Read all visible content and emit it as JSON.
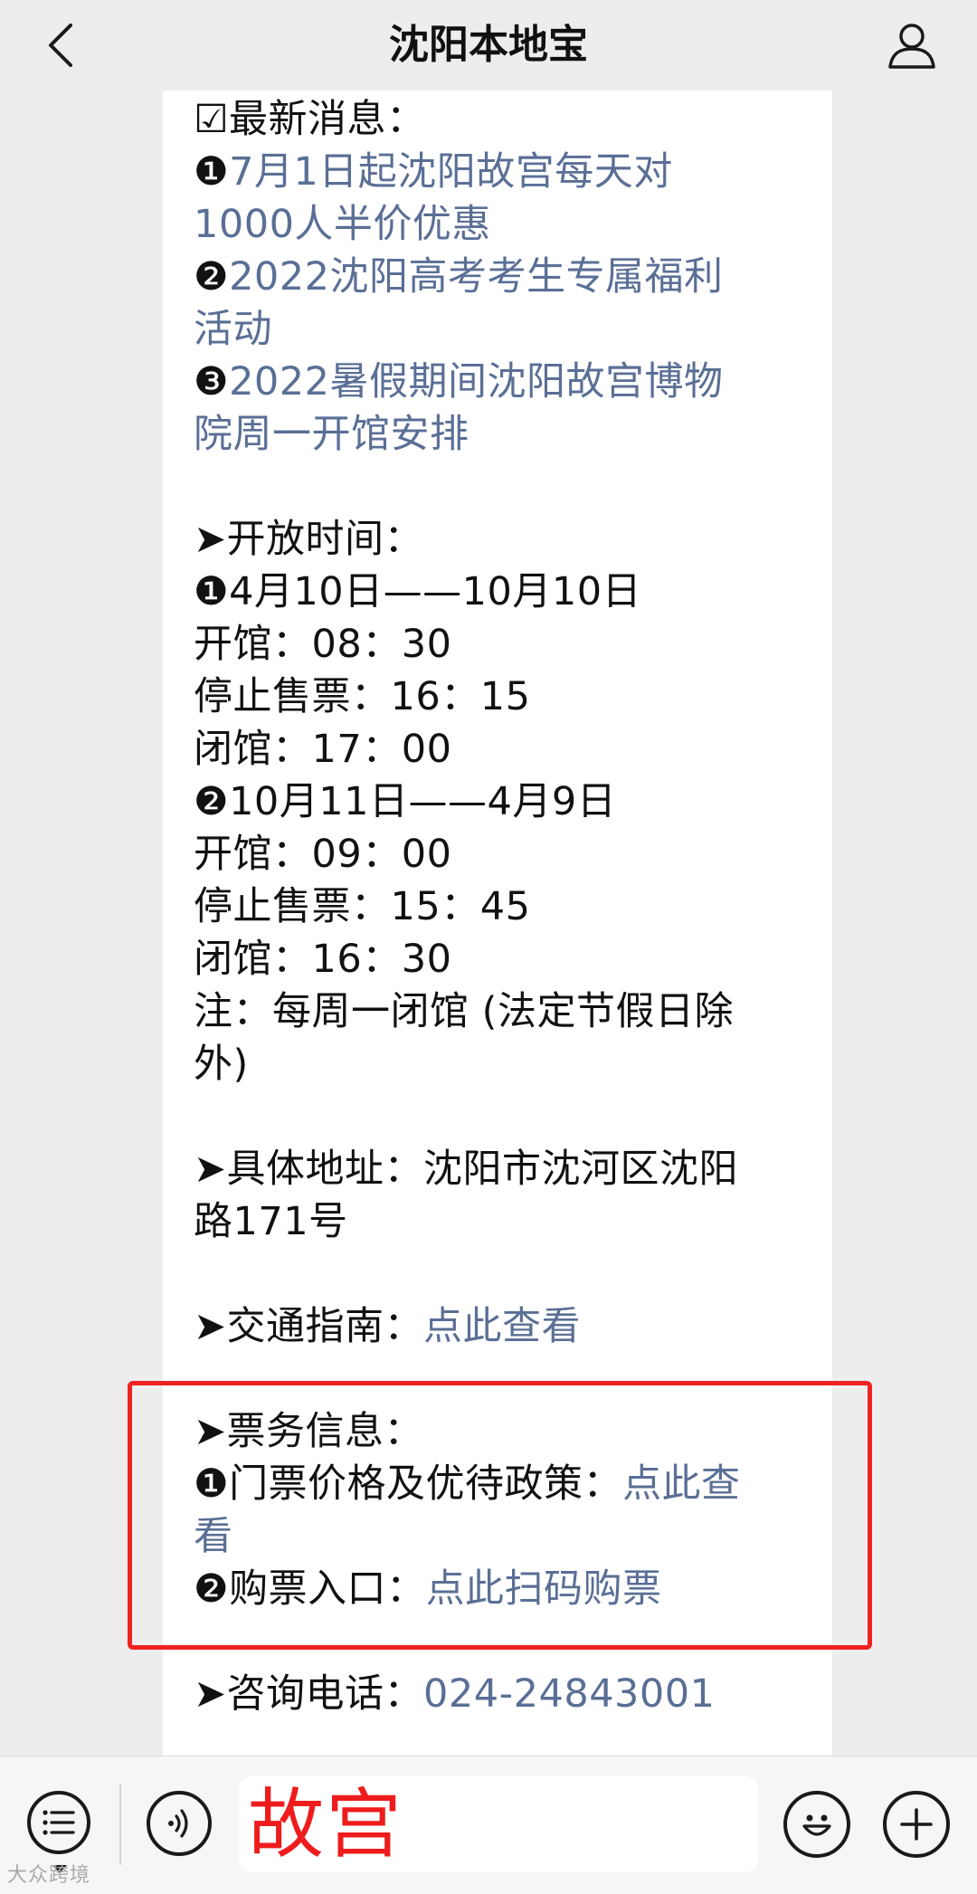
{
  "nav": {
    "title": "沈阳本地宝",
    "back_icon": "chevron-left-icon",
    "profile_icon": "person-icon"
  },
  "message": {
    "news": {
      "heading": "☑最新消息：",
      "items": [
        {
          "marker": "❶",
          "text_line1": "7月1日起沈阳故宫每天对",
          "text_line2": "1000人半价优惠"
        },
        {
          "marker": "❷",
          "text_line1": "2022沈阳高考考生专属福利",
          "text_line2": "活动"
        },
        {
          "marker": "❸",
          "text_line1": "2022暑假期间沈阳故宫博物",
          "text_line2": "院周一开馆安排"
        }
      ]
    },
    "hours": {
      "heading": "➤开放时间：",
      "season1": {
        "marker": "❶",
        "range": "4月10日——10月10日",
        "open": "开馆：08：30",
        "stop_sale": "停止售票：16：15",
        "close": "闭馆：17：00"
      },
      "season2": {
        "marker": "❷",
        "range": "10月11日——4月9日",
        "open": "开馆：09：00",
        "stop_sale": "停止售票：15：45",
        "close": "闭馆：16：30"
      },
      "note_line1": "注：每周一闭馆 (法定节假日除",
      "note_line2": "外)"
    },
    "address": {
      "line1": "➤具体地址：沈阳市沈河区沈阳",
      "line2": "路171号"
    },
    "traffic": {
      "label": "➤交通指南：",
      "link": "点此查看"
    },
    "tickets": {
      "heading": "➤票务信息：",
      "item1_marker": "❶",
      "item1_label": "门票价格及优待政策：",
      "item1_link_line1": "点此查",
      "item1_link_line2": "看",
      "item2_marker": "❷",
      "item2_label": "购票入口：",
      "item2_link": "点此扫码购票"
    },
    "phone": {
      "label": "➤咨询电话：",
      "number": "024-24843001"
    }
  },
  "bottom_bar": {
    "input_value": "故宫",
    "menu_icon": "list-menu-icon",
    "voice_icon": "voice-icon",
    "emoji_icon": "smiley-icon",
    "plus_icon": "plus-icon"
  },
  "watermark": "大众跨境",
  "colors": {
    "link": "#5a6f96",
    "highlight": "#ef2222",
    "input_text": "#ee1c1c",
    "background": "#ededed"
  }
}
